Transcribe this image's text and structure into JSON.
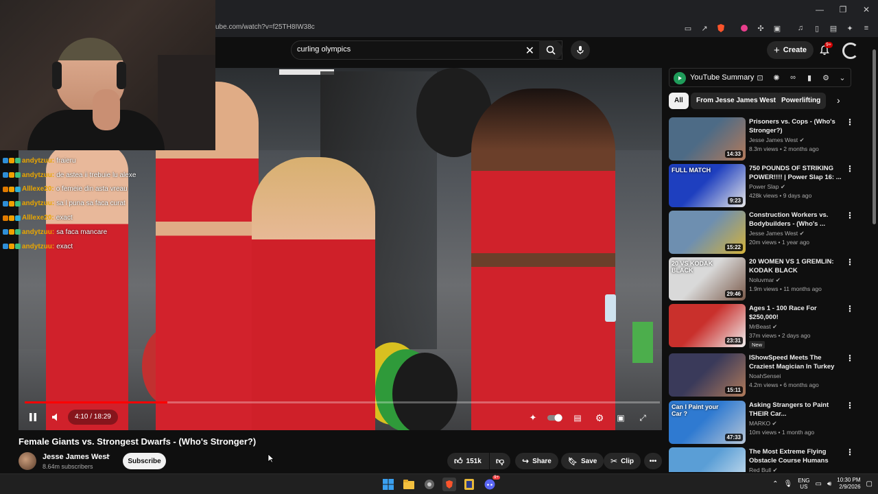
{
  "browser": {
    "url": "ube.com/watch?v=f25TH8IW38c",
    "window_controls": [
      "—",
      "❐",
      "✕"
    ]
  },
  "masthead": {
    "search_query": "curling olympics",
    "create_label": "Create",
    "notification_count": "9+"
  },
  "player": {
    "time": "4:10 / 18:29",
    "progress": 0.225
  },
  "chat": [
    {
      "user": "andytzuu:",
      "message": "fraieru"
    },
    {
      "user": "andytzuu:",
      "message": "de astea ii trebuie lu alexe"
    },
    {
      "user": "Alllexe20:",
      "message": "o femeie din asta vreau"
    },
    {
      "user": "andytzuu:",
      "message": "sa l puna sa faca curat"
    },
    {
      "user": "Alllexe20:",
      "message": "exact"
    },
    {
      "user": "andytzuu:",
      "message": "sa faca mancare"
    },
    {
      "user": "andytzuu:",
      "message": "exact"
    }
  ],
  "video": {
    "title": "Female Giants vs. Strongest Dwarfs - (Who's Stronger?)",
    "channel": "Jesse James West",
    "subscribers": "8.64m subscribers",
    "subscribe_label": "Subscribe",
    "likes": "151k",
    "share_label": "Share",
    "save_label": "Save",
    "clip_label": "Clip"
  },
  "sidebar": {
    "summary_label": "YouTube Summary",
    "chips": [
      "All",
      "From Jesse James West",
      "Powerlifting"
    ],
    "recommendations": [
      {
        "title": "Prisoners vs. Cops - (Who's Stronger?)",
        "channel": "Jesse James West",
        "verified": true,
        "meta": "8.3m views • 2 months ago",
        "duration": "14:33",
        "colors": [
          "#4d6b86",
          "#b47a5a"
        ]
      },
      {
        "title": "750 POUNDS OF STRIKING POWER!!!! | Power Slap 16: ...",
        "channel": "Power Slap",
        "verified": true,
        "meta": "428k views • 9 days ago",
        "duration": "9:23",
        "colors": [
          "#1e3fbf",
          "#e8e8e8"
        ],
        "thumb_text": "FULL MATCH"
      },
      {
        "title": "Construction Workers vs. Bodybuilders - (Who's ...",
        "channel": "Jesse James West",
        "verified": true,
        "meta": "20m views • 1 year ago",
        "duration": "15:22",
        "colors": [
          "#6e8fb0",
          "#d4b23a"
        ]
      },
      {
        "title": "20 WOMEN VS 1 GREMLIN: KODAK BLACK",
        "channel": "Noluvmar",
        "verified": true,
        "meta": "1.9m views • 11 months ago",
        "duration": "29:46",
        "colors": [
          "#d9d9d9",
          "#7a5a4a"
        ],
        "thumb_text": "20 VS KODAK BLACK"
      },
      {
        "title": "Ages 1 - 100 Race For $250,000!",
        "channel": "MrBeast",
        "verified": true,
        "meta": "37m views • 2 days ago",
        "duration": "23:31",
        "colors": [
          "#c9302c",
          "#f0f0f0"
        ],
        "badge": "New"
      },
      {
        "title": "IShowSpeed Meets The Craziest Magician In Turkey",
        "channel": "NoahSensei",
        "verified": false,
        "meta": "4.2m views • 6 months ago",
        "duration": "15:11",
        "colors": [
          "#3a3a5a",
          "#b07a5a"
        ]
      },
      {
        "title": "Asking Strangers to Paint THEIR Car...",
        "channel": "MARKO",
        "verified": true,
        "meta": "10m views • 1 month ago",
        "duration": "47:33",
        "colors": [
          "#2f7ad1",
          "#b8c6d6"
        ],
        "thumb_text": "Can I Paint your Car ?"
      },
      {
        "title": "The Most Extreme Flying Obstacle Course Humans Hav...",
        "channel": "Red Bull",
        "verified": true,
        "meta": "",
        "duration": "",
        "colors": [
          "#5a9ed6",
          "#d8e6f0"
        ]
      }
    ]
  },
  "taskbar": {
    "lang_top": "ENG",
    "lang_bottom": "US",
    "time": "10:30 PM",
    "date": "2/9/2026",
    "discord_badge": "9+"
  },
  "colors": {
    "accent_red": "#ff0000",
    "chat_user": "#e9a600",
    "background": "#0f0f0f"
  }
}
